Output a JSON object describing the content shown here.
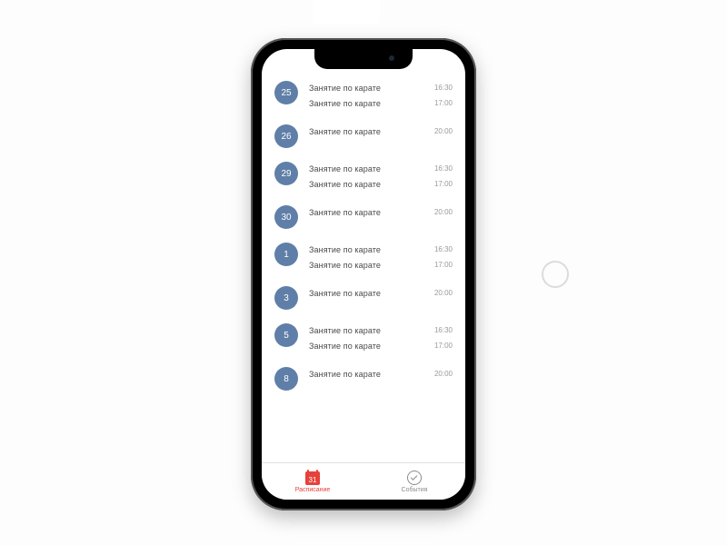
{
  "days": [
    {
      "day": "25",
      "events": [
        {
          "title": "Занятие по карате",
          "time": "16:30"
        },
        {
          "title": "Занятие по карате",
          "time": "17:00"
        }
      ]
    },
    {
      "day": "26",
      "events": [
        {
          "title": "Занятие по карате",
          "time": "20:00"
        }
      ]
    },
    {
      "day": "29",
      "events": [
        {
          "title": "Занятие по карате",
          "time": "16:30"
        },
        {
          "title": "Занятие по карате",
          "time": "17:00"
        }
      ]
    },
    {
      "day": "30",
      "events": [
        {
          "title": "Занятие по карате",
          "time": "20:00"
        }
      ]
    },
    {
      "day": "1",
      "events": [
        {
          "title": "Занятие по карате",
          "time": "16:30"
        },
        {
          "title": "Занятие по карате",
          "time": "17:00"
        }
      ]
    },
    {
      "day": "3",
      "events": [
        {
          "title": "Занятие по карате",
          "time": "20:00"
        }
      ]
    },
    {
      "day": "5",
      "events": [
        {
          "title": "Занятие по карате",
          "time": "16:30"
        },
        {
          "title": "Занятие по карате",
          "time": "17:00"
        }
      ]
    },
    {
      "day": "8",
      "events": [
        {
          "title": "Занятие по карате",
          "time": "20:00"
        }
      ]
    }
  ],
  "tabs": {
    "schedule": {
      "label": "Расписание",
      "icon_day": "31"
    },
    "events": {
      "label": "События"
    }
  }
}
